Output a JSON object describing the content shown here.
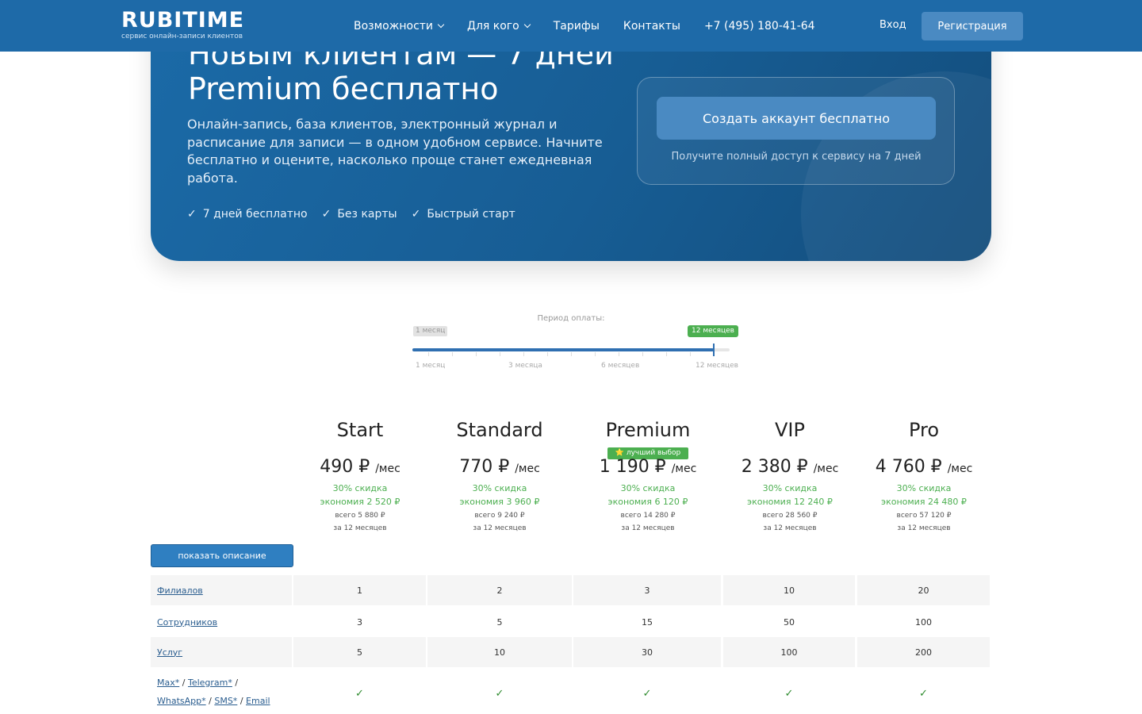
{
  "header": {
    "logo_title": "RUBITIME",
    "logo_subtitle": "сервис онлайн-записи клиентов",
    "nav": [
      {
        "label": "Возможности"
      },
      {
        "label": "Для кого"
      },
      {
        "label": "Тарифы"
      },
      {
        "label": "Контакты"
      },
      {
        "label": "+7 (495) 180-41-64"
      }
    ],
    "login": "Вход",
    "register": "Регистрация"
  },
  "hero": {
    "title": "Новым клиентам — 7 дней Premium бесплатно",
    "description": "Онлайн-запись, база клиентов, электронный журнал и расписание для записи — в одном удобном сервисе. Начните бесплатно и оцените, насколько проще станет ежедневная работа.",
    "checks": [
      "7 дней бесплатно",
      "Без карты",
      "Быстрый старт"
    ],
    "check_glyph": "✓",
    "cta_button": "Создать аккаунт бесплатно",
    "cta_note": "Получите полный доступ к сервису на 7 дней"
  },
  "period": {
    "label": "Период оплаты:",
    "min_badge": "1 месяц",
    "current_badge": "12 месяцев",
    "selected_fraction": 0.95,
    "ticks": [
      "1 месяц",
      "3 месяца",
      "6 месяцев",
      "12 месяцев"
    ]
  },
  "plans": [
    {
      "name": "Start",
      "price": "490 ₽",
      "per": "/мес",
      "discount": "30% скидка",
      "saving": "экономия 2 520 ₽",
      "total": "всего 5 880 ₽",
      "period": "за 12 месяцев"
    },
    {
      "name": "Standard",
      "price": "770 ₽",
      "per": "/мес",
      "discount": "30% скидка",
      "saving": "экономия 3 960 ₽",
      "total": "всего 9 240 ₽",
      "period": "за 12 месяцев"
    },
    {
      "name": "Premium",
      "badge": "⭐ лучший выбор",
      "price": "1 190 ₽",
      "per": "/мес",
      "discount": "30% скидка",
      "saving": "экономия 6 120 ₽",
      "total": "всего 14 280 ₽",
      "period": "за 12 месяцев"
    },
    {
      "name": "VIP",
      "price": "2 380 ₽",
      "per": "/мес",
      "discount": "30% скидка",
      "saving": "экономия 12 240 ₽",
      "total": "всего 28 560 ₽",
      "period": "за 12 месяцев"
    },
    {
      "name": "Pro",
      "price": "4 760 ₽",
      "per": "/мес",
      "discount": "30% скидка",
      "saving": "экономия 24 480 ₽",
      "total": "всего 57 120 ₽",
      "period": "за 12 месяцев"
    }
  ],
  "show_description": "показать описание",
  "table": {
    "rows": [
      {
        "label": "Филиалов",
        "values": [
          "1",
          "2",
          "3",
          "10",
          "20"
        ]
      },
      {
        "label": "Сотрудников",
        "values": [
          "3",
          "5",
          "15",
          "50",
          "100"
        ]
      },
      {
        "label": "Услуг",
        "values": [
          "5",
          "10",
          "30",
          "100",
          "200"
        ]
      }
    ],
    "messaging": {
      "items": [
        "Max*",
        "Telegram*",
        "WhatsApp*",
        "SMS*",
        "Email"
      ],
      "sep": "/",
      "values": [
        "✓",
        "✓",
        "✓",
        "✓",
        "✓"
      ]
    }
  }
}
